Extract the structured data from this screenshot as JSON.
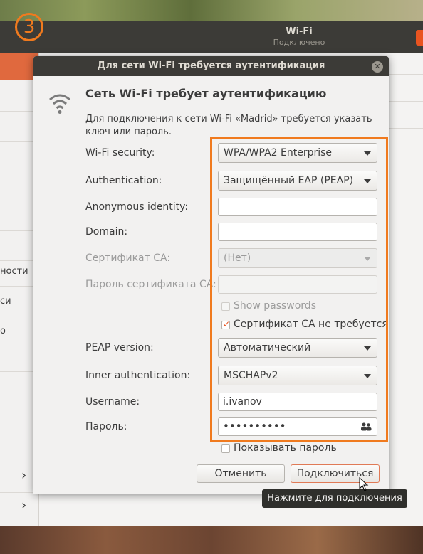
{
  "badge": {
    "number": "3"
  },
  "background_window": {
    "title": "Wi-Fi",
    "subtitle": "Подключено",
    "sidebar_fragments": [
      "ности",
      "си",
      "о"
    ]
  },
  "dialog": {
    "title": "Для сети Wi-Fi требуется аутентификация",
    "heading": "Сеть Wi-Fi требует аутентификацию",
    "description": "Для подключения к сети Wi-Fi «Madrid» требуется указать ключ или пароль.",
    "fields": {
      "wifi_security": {
        "label": "Wi-Fi security:",
        "value": "WPA/WPA2 Enterprise"
      },
      "authentication": {
        "label": "Authentication:",
        "value": "Защищённый EAP (PEAP)"
      },
      "anonymous_identity": {
        "label": "Anonymous identity:",
        "value": ""
      },
      "domain": {
        "label": "Domain:",
        "value": ""
      },
      "ca_certificate": {
        "label": "Сертификат CA:",
        "value": "(Нет)"
      },
      "ca_cert_password": {
        "label": "Пароль сертификата CA:",
        "value": ""
      },
      "show_passwords": {
        "label": "Show passwords",
        "checked": false
      },
      "no_ca_required": {
        "label": "Сертификат CA не требуется",
        "checked": true
      },
      "peap_version": {
        "label": "PEAP version:",
        "value": "Автоматический"
      },
      "inner_auth": {
        "label": "Inner authentication:",
        "value": "MSCHAPv2"
      },
      "username": {
        "label": "Username:",
        "value": "i.ivanov"
      },
      "password": {
        "label": "Пароль:",
        "value": "••••••••••"
      },
      "show_password": {
        "label": "Показывать пароль",
        "checked": false
      }
    },
    "buttons": {
      "cancel": "Отменить",
      "connect": "Подключиться"
    },
    "tooltip": "Нажмите для подключения"
  },
  "colors": {
    "accent": "#e95420",
    "highlight": "#f07a1e",
    "titlebar": "#3c3b37"
  }
}
